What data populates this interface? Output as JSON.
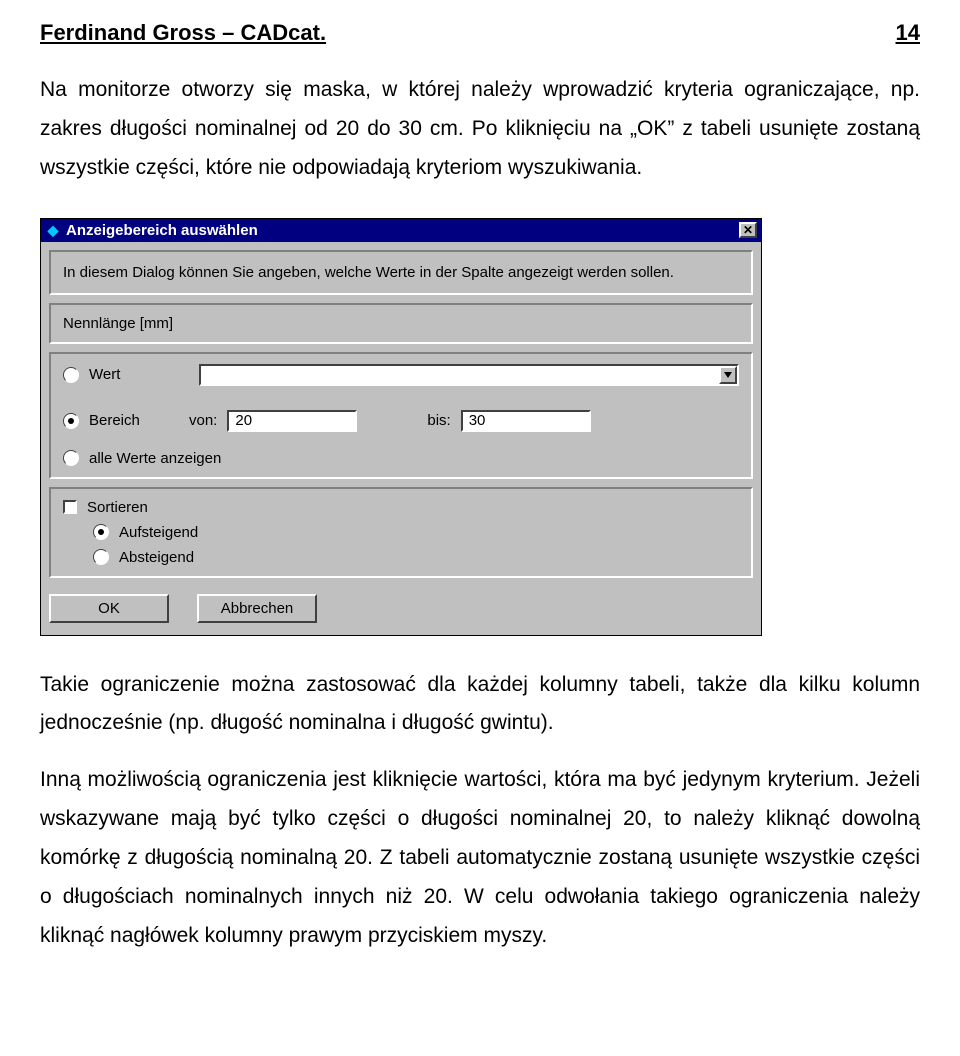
{
  "header": {
    "title": "Ferdinand Gross – CADcat.",
    "page": "14"
  },
  "body": {
    "p1": "Na monitorze otworzy się maska, w której należy wprowadzić kryteria ograniczające, np. zakres długości nominalnej od 20 do 30 cm. Po kliknięciu na „OK” z tabeli usunięte zostaną wszystkie części, które nie odpowiadają kryteriom wyszukiwania.",
    "p2": "Takie ograniczenie można zastosować dla każdej kolumny tabeli, także dla kilku kolumn jednocześnie (np. długość nominalna i długość gwintu).",
    "p3": "Inną możliwością ograniczenia jest kliknięcie wartości, która ma być jedynym kryterium. Jeżeli wskazywane mają być tylko części o długości nominalnej 20, to należy kliknąć dowolną komórkę z długością nominalną 20. Z tabeli automatycznie zostaną usunięte wszystkie części o długościach nominalnych innych niż 20. W celu odwołania takiego ograniczenia należy kliknąć nagłówek kolumny prawym przyciskiem myszy."
  },
  "dialog": {
    "title": "Anzeigebereich auswählen",
    "intro": "In diesem Dialog können Sie angeben, welche Werte in der Spalte angezeigt werden sollen.",
    "column": "Nennlänge [mm]",
    "radio_wert": "Wert",
    "wert_value": "",
    "radio_bereich": "Bereich",
    "von_label": "von:",
    "von_value": "20",
    "bis_label": "bis:",
    "bis_value": "30",
    "radio_all": "alle Werte anzeigen",
    "sort_label": "Sortieren",
    "radio_asc": "Aufsteigend",
    "radio_desc": "Absteigend",
    "btn_ok": "OK",
    "btn_cancel": "Abbrechen"
  }
}
